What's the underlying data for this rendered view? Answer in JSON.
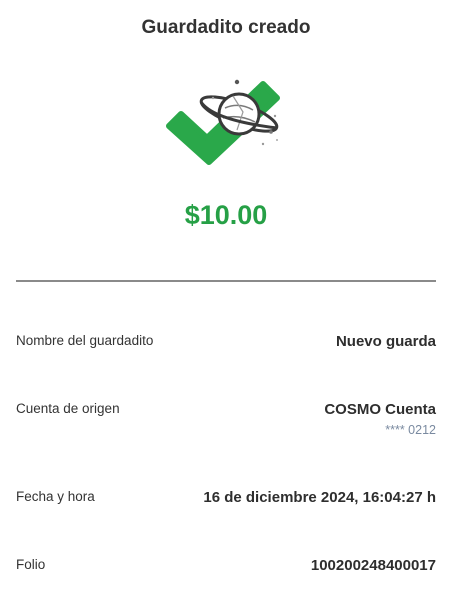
{
  "header": {
    "title": "Guardadito creado"
  },
  "illustration": {
    "icon": "check-planet-icon",
    "check_color": "#2aa84a",
    "planet_color": "#555555"
  },
  "amount": "$10.00",
  "details": {
    "name": {
      "label": "Nombre del guardadito",
      "value": "Nuevo guarda"
    },
    "origin": {
      "label": "Cuenta de origen",
      "value": "COSMO Cuenta",
      "account_mask": "**** 0212"
    },
    "datetime": {
      "label": "Fecha y hora",
      "value": "16 de diciembre 2024, 16:04:27 h"
    },
    "folio": {
      "label": "Folio",
      "value": "100200248400017"
    }
  },
  "colors": {
    "accent_green": "#26a046",
    "sub_text": "#7a8aa0"
  }
}
